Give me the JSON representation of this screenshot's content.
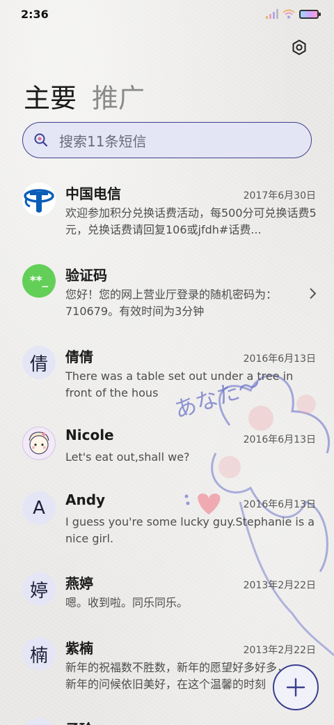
{
  "status_bar": {
    "time": "2:36"
  },
  "header": {
    "tab_primary": "主要",
    "tab_promo": "推广"
  },
  "search": {
    "placeholder": "搜索11条短信"
  },
  "messages": [
    {
      "avatar": "",
      "sender": "中国电信",
      "date": "2017年6月30日",
      "preview": "欢迎参加积分兑换话费活动，每500分可兑换话费5元，兑换话费请回复106或jfdh#话费..."
    },
    {
      "avatar": "**_",
      "sender": "验证码",
      "date": "",
      "preview": "您好！您的网上营业厅登录的随机密码为：710679。有效时间为3分钟"
    },
    {
      "avatar": "倩",
      "sender": "倩倩",
      "date": "2016年6月13日",
      "preview": "There was a table set out under a tree in front of the hous"
    },
    {
      "avatar": "",
      "sender": "Nicole",
      "date": "2016年6月13日",
      "preview": "Let's eat out,shall we?"
    },
    {
      "avatar": "A",
      "sender": "Andy",
      "date": "2016年6月13日",
      "preview": "I guess you're some lucky guy.Stephanie is a nice girl."
    },
    {
      "avatar": "婷",
      "sender": "燕婷",
      "date": "2013年2月22日",
      "preview": "嗯。收到啦。同乐同乐。"
    },
    {
      "avatar": "楠",
      "sender": "紫楠",
      "date": "2013年2月22日",
      "preview": "新年的祝福数不胜数，新年的愿望好多好多，新年的问候依旧美好，在这个温馨的时刻"
    },
    {
      "avatar": "",
      "sender": "子玲",
      "date": "",
      "preview": ""
    }
  ],
  "doodle": {
    "text": "あなた〜"
  },
  "colors": {
    "accent": "#3b3f8f",
    "search_bg": "#e2e4f6",
    "avatar_bg": "#e4e6f6",
    "verify_green": "#63cf58",
    "telecom_blue": "#0b5db8"
  },
  "icons": {
    "settings": "gear-icon",
    "search": "search-icon",
    "fab": "plus-icon",
    "chevron": "chevron-right-icon"
  }
}
